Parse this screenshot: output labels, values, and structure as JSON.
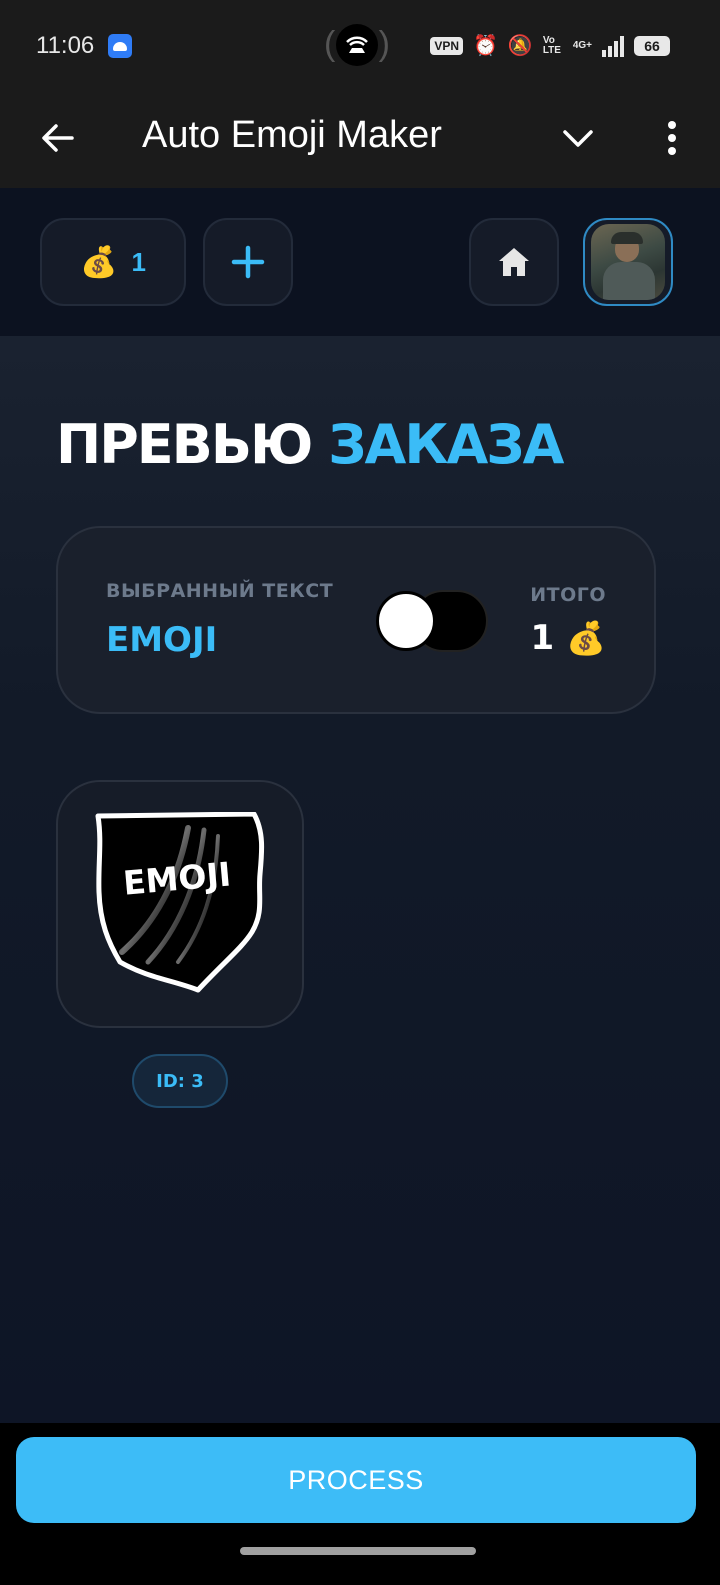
{
  "status_bar": {
    "time": "11:06",
    "vpn": "VPN",
    "volte": "Vo LTE",
    "network": "4G+",
    "battery": "66"
  },
  "app_bar": {
    "title": "Auto Emoji Maker",
    "icons": {
      "back": "arrow-left",
      "dropdown": "chevron-down",
      "menu": "more-vertical"
    }
  },
  "header": {
    "balance_icon": "💰",
    "balance": "1",
    "icons": {
      "add": "plus",
      "home": "home"
    }
  },
  "main": {
    "title_part1": "ПРЕВЬЮ",
    "title_part2": "ЗАКАЗА",
    "summary": {
      "selected_label": "ВЫБРАННЫЙ ТЕКСТ",
      "selected_value": "EMOJI",
      "total_label": "ИТОГО",
      "total_value": "1",
      "total_icon": "💰",
      "toggle_on": false
    },
    "emoji": {
      "text": "EMOJI",
      "id_label": "ID: 3"
    }
  },
  "footer": {
    "process_label": "PROCESS"
  },
  "colors": {
    "accent": "#3bbcf7",
    "background": "#0c1220",
    "card": "#1a202c",
    "bar": "#1b1b1b"
  }
}
